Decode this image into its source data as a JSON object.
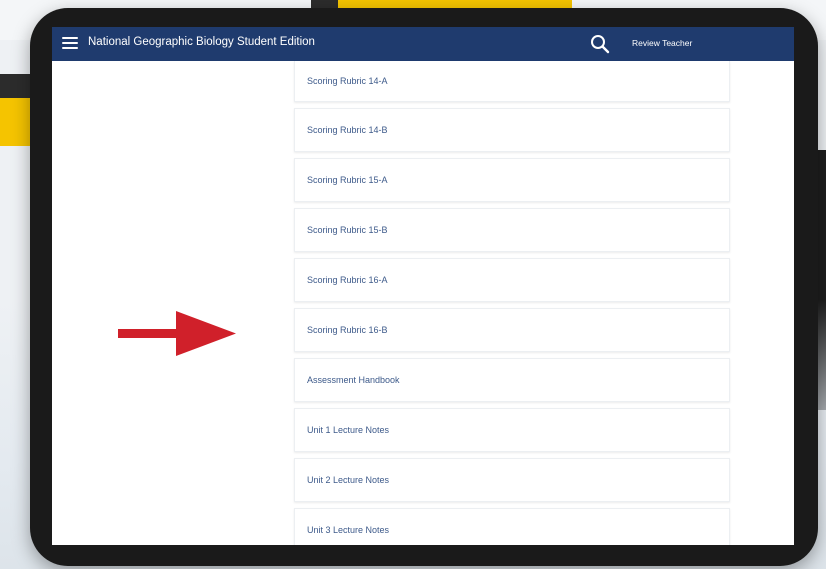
{
  "app": {
    "title": "National Geographic Biology Student Edition",
    "user": "Review Teacher"
  },
  "colors": {
    "topbar": "#1f3b6e",
    "link": "#3d5a8a",
    "arrow": "#d0202a",
    "accent_yellow": "#f5c400"
  },
  "icons": {
    "menu": "hamburger-menu-icon",
    "search": "search-icon",
    "pointer": "red-arrow-icon"
  },
  "resources": {
    "items": [
      {
        "label": "Scoring Rubric 14-A"
      },
      {
        "label": "Scoring Rubric 14-B"
      },
      {
        "label": "Scoring Rubric 15-A"
      },
      {
        "label": "Scoring Rubric 15-B"
      },
      {
        "label": "Scoring Rubric 16-A"
      },
      {
        "label": "Scoring Rubric 16-B"
      },
      {
        "label": "Assessment Handbook"
      },
      {
        "label": "Unit 1 Lecture Notes"
      },
      {
        "label": "Unit 2 Lecture Notes"
      },
      {
        "label": "Unit 3 Lecture Notes"
      }
    ]
  }
}
